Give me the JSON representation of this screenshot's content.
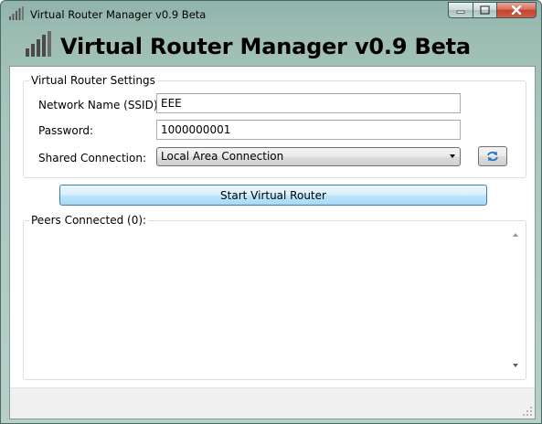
{
  "window": {
    "title": "Virtual Router Manager v0.9 Beta",
    "icon": "wifi-signal-icon",
    "controls": [
      "minimize-icon",
      "maximize-icon",
      "close-icon"
    ]
  },
  "header": {
    "title": "Virtual Router Manager v0.9 Beta",
    "icon": "wifi-signal-icon"
  },
  "settings": {
    "legend": "Virtual Router Settings",
    "ssid_label": "Network Name (SSID):",
    "ssid_value": "EEE",
    "password_label": "Password:",
    "password_value": "1000000001",
    "shared_label": "Shared Connection:",
    "shared_value": "Local Area Connection",
    "refresh_icon": "refresh-icon"
  },
  "actions": {
    "start_label": "Start Virtual Router"
  },
  "peers": {
    "legend": "Peers Connected (0):",
    "items": []
  },
  "colors": {
    "accent_border": "#3c7fb1",
    "button_top": "#eaf6fd",
    "button_bottom": "#a7d9f5",
    "refresh_arrow": "#2a6fc4",
    "close_button": "#c4442f"
  }
}
